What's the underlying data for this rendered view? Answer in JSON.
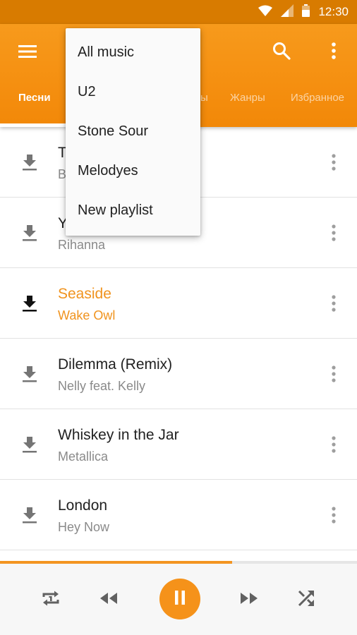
{
  "status_bar": {
    "time": "12:30"
  },
  "app_bar": {
    "tabs": [
      {
        "label": "Песни",
        "active": true
      },
      {
        "label": "ы",
        "active": false
      },
      {
        "label": "Жанры",
        "active": false
      },
      {
        "label": "Избранное",
        "active": false
      }
    ]
  },
  "dropdown": {
    "items": [
      "All music",
      "U2",
      "Stone Sour",
      "Melodyes",
      "New playlist"
    ]
  },
  "songs": [
    {
      "title": "T",
      "artist": "B"
    },
    {
      "title": "Y",
      "artist": "Rihanna"
    },
    {
      "title": "Seaside",
      "artist": "Wake Owl",
      "playing": true
    },
    {
      "title": "Dilemma (Remix)",
      "artist": "Nelly feat. Kelly"
    },
    {
      "title": "Whiskey in the Jar",
      "artist": "Metallica"
    },
    {
      "title": "London",
      "artist": "Hey Now"
    }
  ],
  "player": {
    "progress": 0.65
  },
  "colors": {
    "accent": "#f5921a",
    "status_bar": "#d87b00",
    "app_bar": "#f79a1c"
  },
  "icons": {
    "status": [
      "wifi-icon",
      "signal-icon",
      "battery-icon"
    ],
    "app_bar": [
      "menu-icon",
      "search-icon",
      "more-vert-icon"
    ],
    "player": [
      "repeat-one-icon",
      "previous-icon",
      "pause-icon",
      "next-icon",
      "shuffle-icon"
    ]
  }
}
